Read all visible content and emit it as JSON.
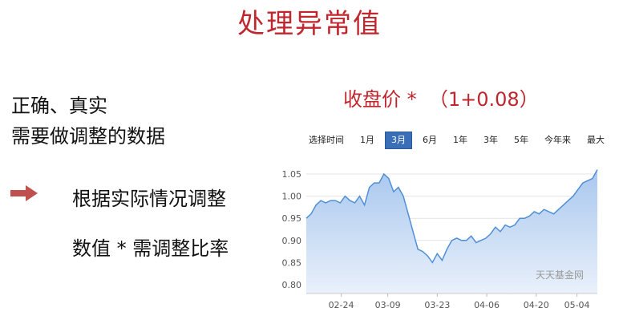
{
  "slide": {
    "title": "处理异常值",
    "left_lines": [
      "正确、真实",
      "需要做调整的数据"
    ],
    "points": [
      "根据实际情况调整",
      "数值 * 需调整比率"
    ],
    "formula": "收盘价 *  （1+0.08）"
  },
  "range_tabs": [
    {
      "label": "选择时间",
      "active": false
    },
    {
      "label": "1月",
      "active": false
    },
    {
      "label": "3月",
      "active": true
    },
    {
      "label": "6月",
      "active": false
    },
    {
      "label": "1年",
      "active": false
    },
    {
      "label": "3年",
      "active": false
    },
    {
      "label": "5年",
      "active": false
    },
    {
      "label": "今年来",
      "active": false
    },
    {
      "label": "最大",
      "active": false
    }
  ],
  "watermark": "天天基金网",
  "colors": {
    "accent": "#c0262d",
    "line": "#4f8fd6",
    "fill_top": "#a9c7ee",
    "fill_bottom": "#e9f1fb"
  },
  "chart_data": {
    "type": "area",
    "xlabel": "",
    "ylabel": "",
    "ylim": [
      0.78,
      1.07
    ],
    "yticks": [
      1.05,
      1.0,
      0.95,
      0.9,
      0.85,
      0.8
    ],
    "xticks": [
      "02-24",
      "03-09",
      "03-23",
      "04-06",
      "04-20",
      "05-04"
    ],
    "grid": true,
    "values": [
      0.95,
      0.96,
      0.98,
      0.99,
      0.985,
      0.99,
      0.99,
      0.985,
      1.0,
      0.99,
      0.985,
      1.0,
      0.98,
      1.02,
      1.03,
      1.03,
      1.05,
      1.04,
      1.01,
      1.02,
      1.0,
      0.96,
      0.92,
      0.88,
      0.875,
      0.865,
      0.85,
      0.87,
      0.855,
      0.88,
      0.9,
      0.905,
      0.9,
      0.9,
      0.91,
      0.895,
      0.9,
      0.905,
      0.915,
      0.93,
      0.92,
      0.935,
      0.93,
      0.935,
      0.95,
      0.95,
      0.955,
      0.965,
      0.96,
      0.97,
      0.965,
      0.96,
      0.97,
      0.98,
      0.99,
      1.0,
      1.015,
      1.03,
      1.035,
      1.04,
      1.06
    ]
  }
}
